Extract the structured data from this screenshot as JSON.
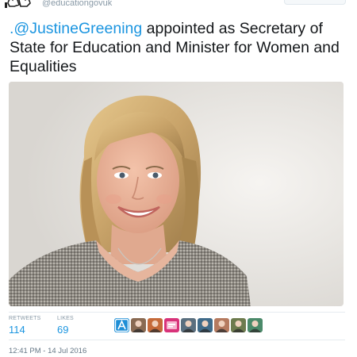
{
  "account": {
    "handle": "@educationgovuk",
    "avatar_icon": "royal-crest-icon"
  },
  "tweet": {
    "mention": ".@JustineGreening",
    "text": " appointed as Secretary of State for Education and Minister for Women and Equalities"
  },
  "photo": {
    "subject": "portrait-photo"
  },
  "stats": {
    "retweets_label": "RETWEETS",
    "retweets": "114",
    "likes_label": "LIKES",
    "likes": "69"
  },
  "likers": [
    {
      "icon": "letter-a-app-icon",
      "color": "#1d8ed6"
    },
    {
      "icon": "user-avatar-icon",
      "color": "#8a6a52"
    },
    {
      "icon": "user-avatar-icon",
      "color": "#c56a3a"
    },
    {
      "icon": "logo-avatar-icon",
      "color": "#d8337a"
    },
    {
      "icon": "user-avatar-icon",
      "color": "#5a6f7f"
    },
    {
      "icon": "user-avatar-icon",
      "color": "#3f6b8a"
    },
    {
      "icon": "user-avatar-icon",
      "color": "#b57a5f"
    },
    {
      "icon": "user-avatar-icon",
      "color": "#6d7b4e"
    },
    {
      "icon": "user-avatar-icon",
      "color": "#4b8a6a"
    }
  ],
  "timestamp": "12:41 PM - 14 Jul 2016",
  "colors": {
    "link": "#1b95e0",
    "muted": "#8899a6"
  }
}
